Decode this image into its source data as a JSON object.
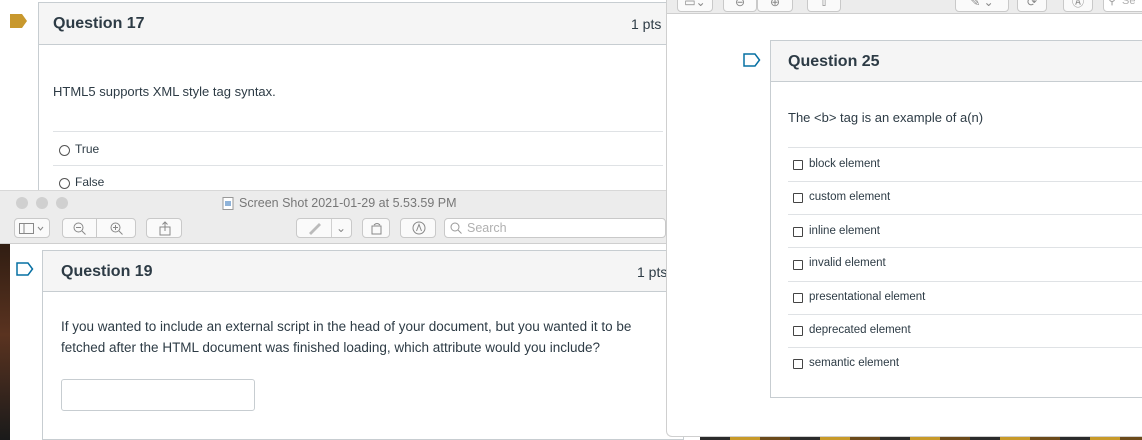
{
  "left": {
    "q17": {
      "title": "Question 17",
      "points": "1 pts",
      "prompt": "HTML5 supports XML style tag syntax.",
      "options": [
        "True",
        "False"
      ]
    },
    "q19": {
      "title": "Question 19",
      "points": "1 pts",
      "prompt_line1": "If you wanted to include an external script in the head of your document, but you wanted it to be",
      "prompt_line2": "fetched after the HTML document was finished loading, which attribute would you include?",
      "answer_value": ""
    }
  },
  "preview_window": {
    "title": "Screen Shot 2021-01-29 at 5.53.59 PM",
    "search_placeholder": "Search"
  },
  "right": {
    "search_partial": "Se",
    "q25": {
      "title": "Question 25",
      "prompt": "The <b> tag is an example of a(n)",
      "options": [
        "block element",
        "custom element",
        "inline element",
        "invalid element",
        "presentational element",
        "deprecated element",
        "semantic element"
      ]
    }
  },
  "colors": {
    "flag_active": "#c8982d",
    "flag_outline": "#0770a3",
    "header_bg": "#f5f5f5",
    "border": "#c7cdd1"
  }
}
